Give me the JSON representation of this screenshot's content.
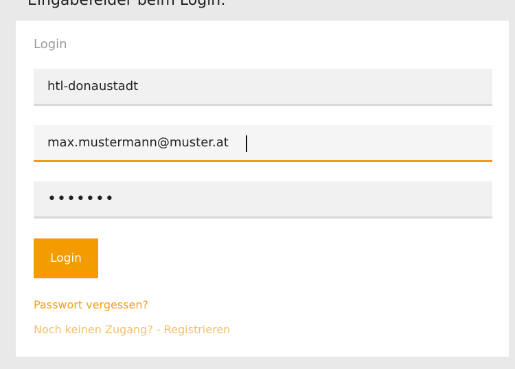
{
  "page": {
    "partial_heading": "Eingabefelder beim Login:"
  },
  "login": {
    "title": "Login",
    "tenant_value": "htl-donaustadt",
    "email_value": "max.mustermann@muster.at",
    "password_mask": "•••••••",
    "submit_label": "Login",
    "forgot_link": "Passwort vergessen?",
    "register_link": "Noch keinen Zugang? - Registrieren"
  },
  "colors": {
    "accent": "#f49b00",
    "link_primary": "#f0a020",
    "link_secondary": "#f4bf6a",
    "field_bg": "#f1f1f1",
    "page_bg": "#e9e9e9"
  }
}
